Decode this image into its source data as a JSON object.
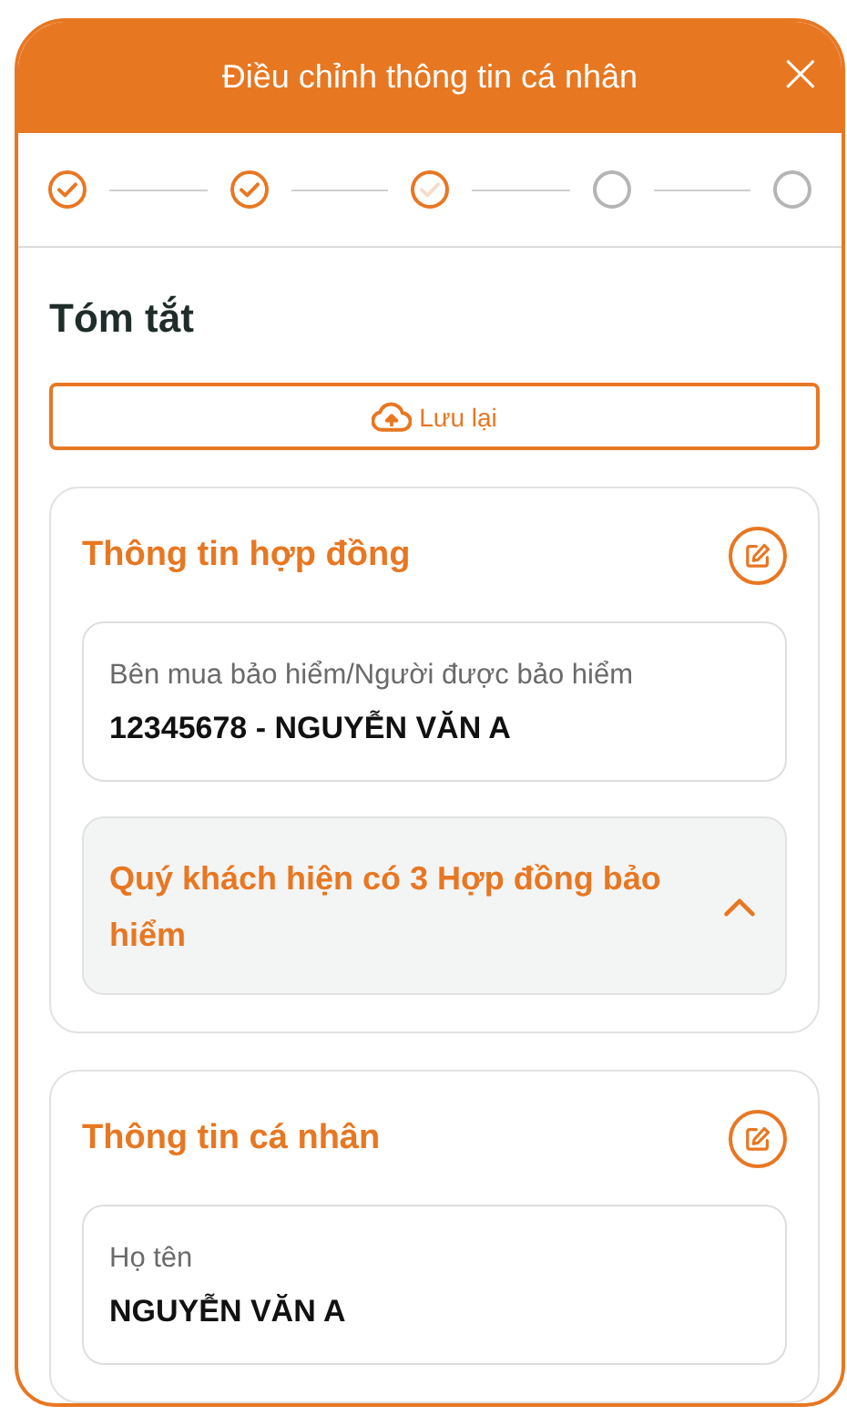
{
  "header": {
    "title": "Điều chỉnh thông tin cá nhân",
    "close": "×"
  },
  "steps": [
    {
      "kind": "done"
    },
    {
      "kind": "done"
    },
    {
      "kind": "current"
    },
    {
      "kind": "pending"
    },
    {
      "kind": "pending"
    }
  ],
  "section_title": "Tóm tắt",
  "save_button": {
    "label": "Lưu lại"
  },
  "cards": [
    {
      "title": "Thông tin hợp đồng",
      "fields": [
        {
          "label": "Bên mua bảo hiểm/Người được bảo hiểm",
          "value": "12345678 - NGUYỄN VĂN A"
        }
      ],
      "collapsible": {
        "text": "Quý khách hiện có 3 Hợp đồng bảo hiểm",
        "expanded": true
      }
    },
    {
      "title": "Thông tin cá nhân",
      "fields": [
        {
          "label": "Họ tên",
          "value": "NGUYỄN VĂN A"
        }
      ]
    }
  ]
}
